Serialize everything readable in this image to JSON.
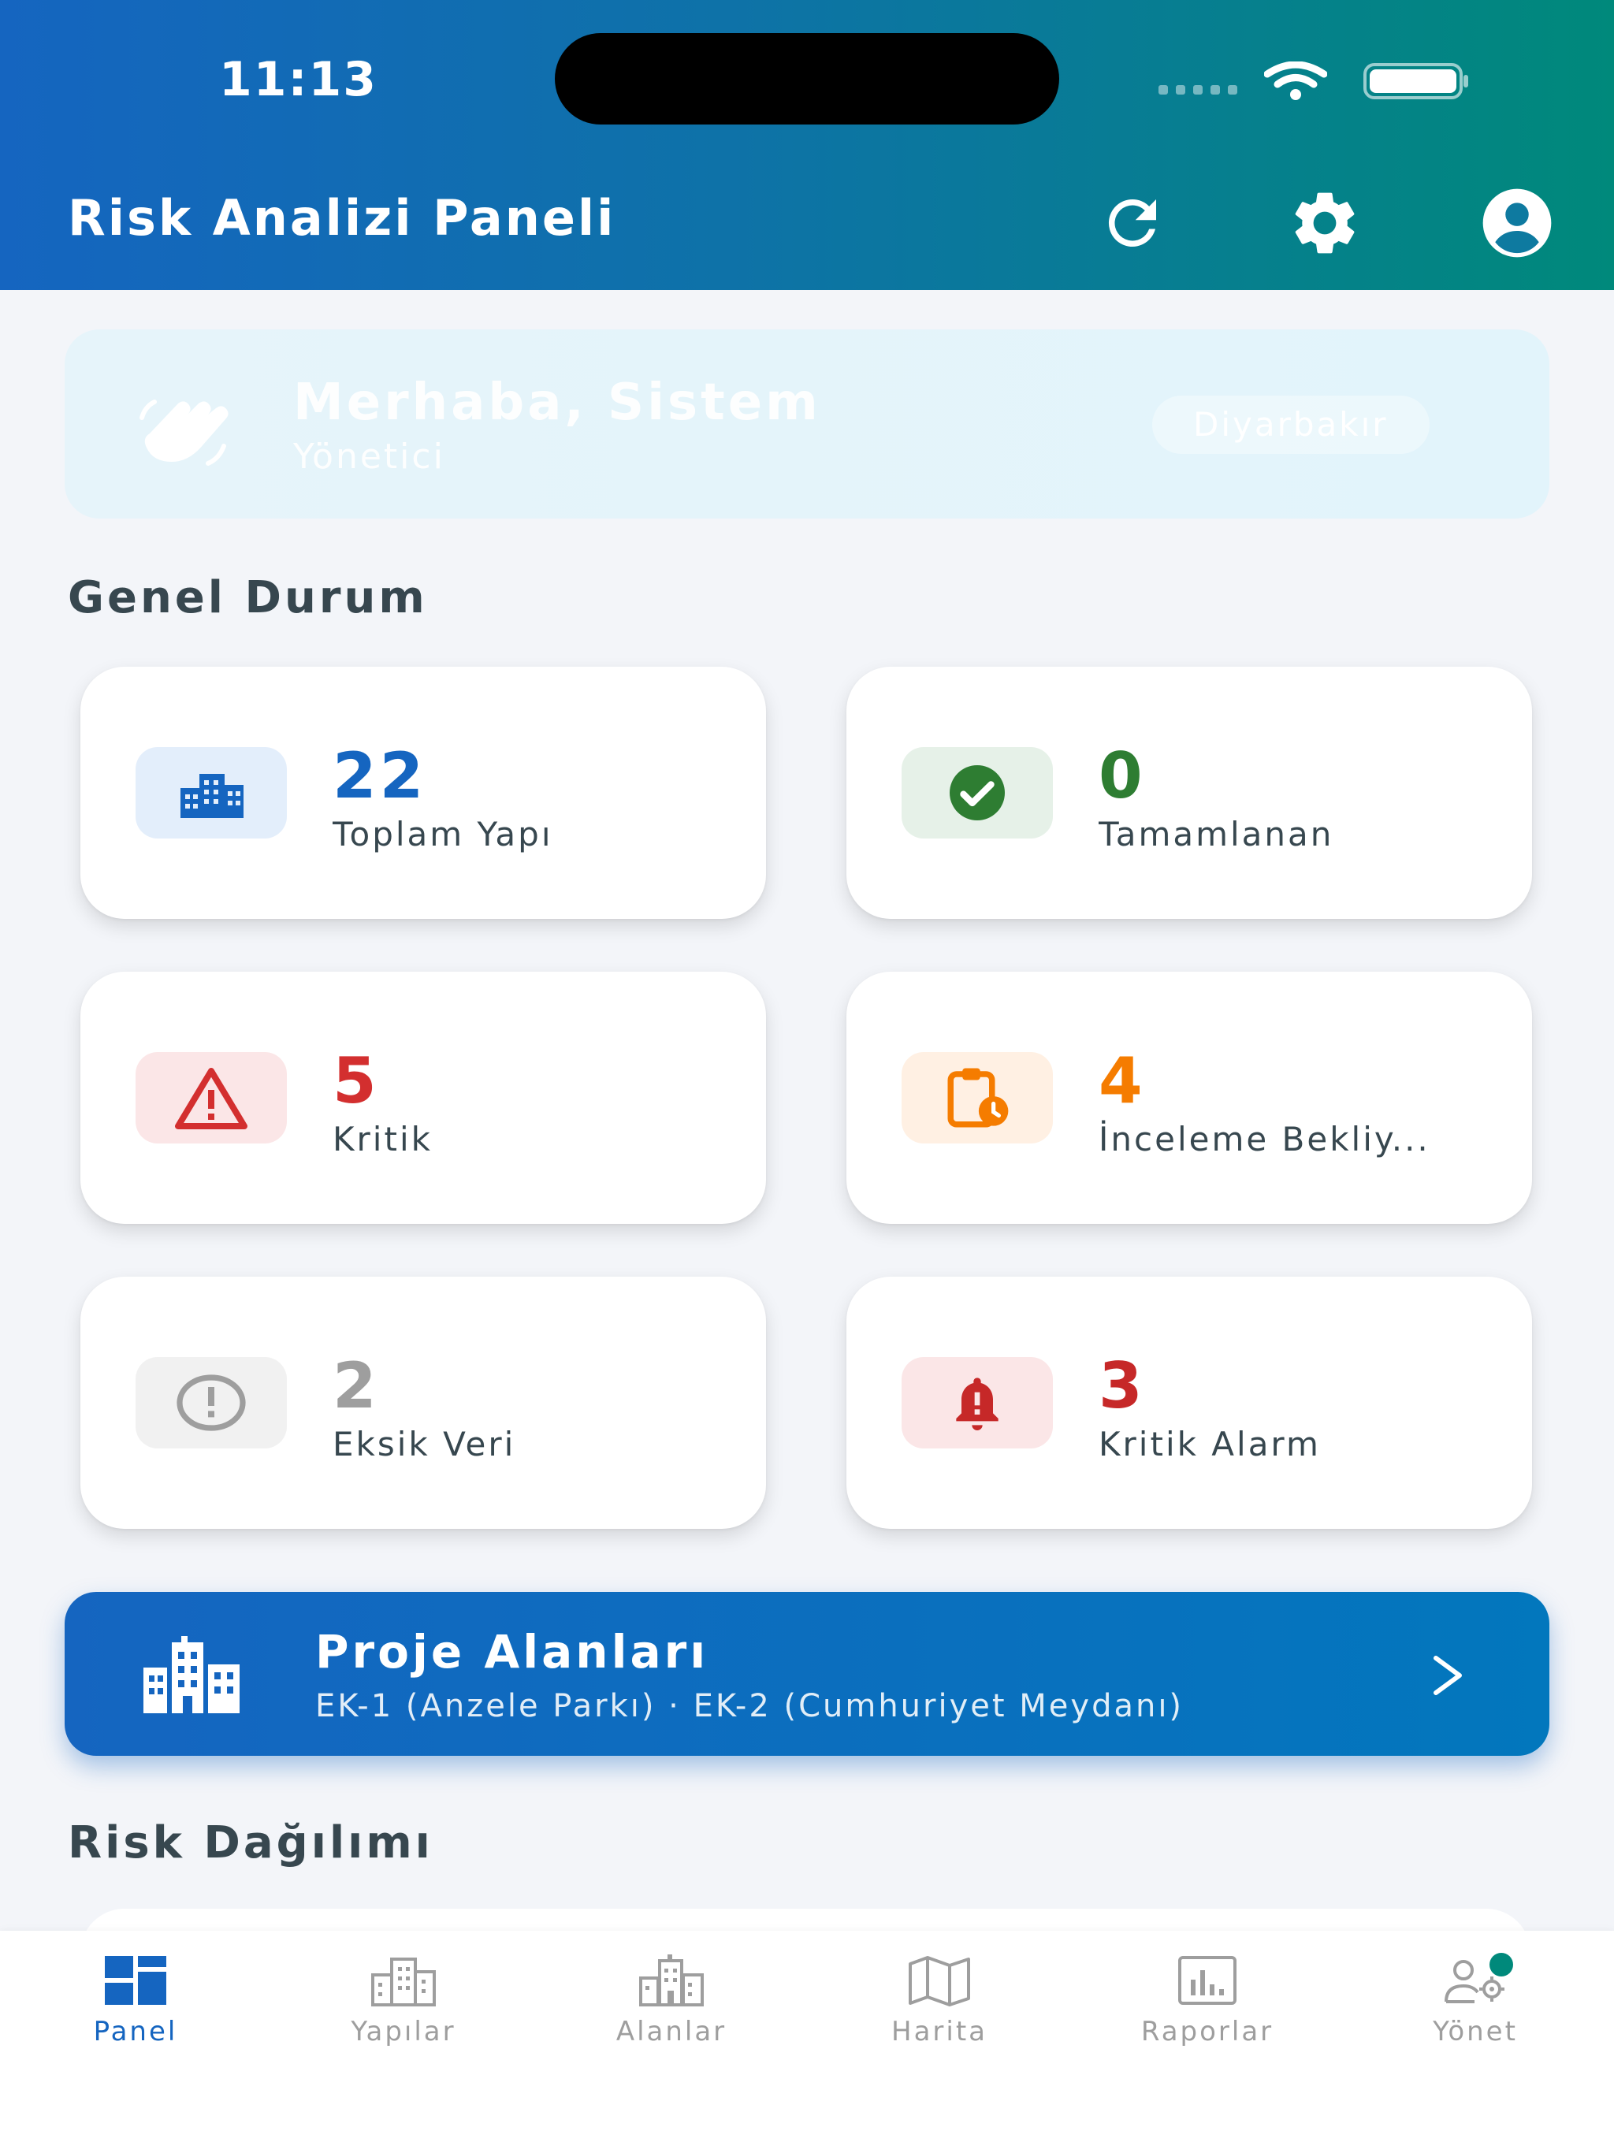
{
  "status_bar": {
    "time": "11:13",
    "wifi_icon": "wifi-icon",
    "battery_icon": "battery-icon"
  },
  "header": {
    "title": "Risk Analizi Paneli",
    "actions": [
      {
        "name": "refresh",
        "icon": "refresh-icon"
      },
      {
        "name": "settings",
        "icon": "gear-icon"
      },
      {
        "name": "account",
        "icon": "account-icon"
      }
    ],
    "gradient": [
      "#1565c0",
      "#00897b"
    ]
  },
  "welcome": {
    "icon": "waving-hand-icon",
    "title": "Merhaba, Sistem",
    "role": "Yönetici",
    "city": "Diyarbakır"
  },
  "general_status": {
    "title": "Genel Durum",
    "cards": [
      {
        "value": "22",
        "label": "Toplam Yapı",
        "icon": "buildings-icon",
        "color": "#1565c0",
        "bg": "#e3eefb"
      },
      {
        "value": "0",
        "label": "Tamamlanan",
        "icon": "check-circle-icon",
        "color": "#2e7d32",
        "bg": "#e6f1e8"
      },
      {
        "value": "5",
        "label": "Kritik",
        "icon": "warning-icon",
        "color": "#d32f2f",
        "bg": "#fbe6e7"
      },
      {
        "value": "4",
        "label": "İnceleme Bekliy...",
        "icon": "clipboard-clock-icon",
        "color": "#f57c00",
        "bg": "#fff0e3"
      },
      {
        "value": "2",
        "label": "Eksik Veri",
        "icon": "alert-circle-icon",
        "color": "#9e9e9e",
        "bg": "#f1f1f1"
      },
      {
        "value": "3",
        "label": "Kritik Alarm",
        "icon": "bell-alert-icon",
        "color": "#c62828",
        "bg": "#fbe6e7"
      }
    ]
  },
  "project_areas": {
    "icon": "city-icon",
    "title": "Proje Alanları",
    "subtitle": "EK-1 (Anzele Parkı) · EK-2 (Cumhuriyet Meydanı)"
  },
  "risk_distribution": {
    "title": "Risk Dağılımı"
  },
  "bottom_nav": {
    "active": "Panel",
    "items": [
      {
        "label": "Panel",
        "icon": "dashboard-icon"
      },
      {
        "label": "Yapılar",
        "icon": "buildings-icon"
      },
      {
        "label": "Alanlar",
        "icon": "city-icon"
      },
      {
        "label": "Harita",
        "icon": "map-icon"
      },
      {
        "label": "Raporlar",
        "icon": "chart-box-icon"
      },
      {
        "label": "Yönet",
        "icon": "users-cog-icon"
      }
    ]
  }
}
